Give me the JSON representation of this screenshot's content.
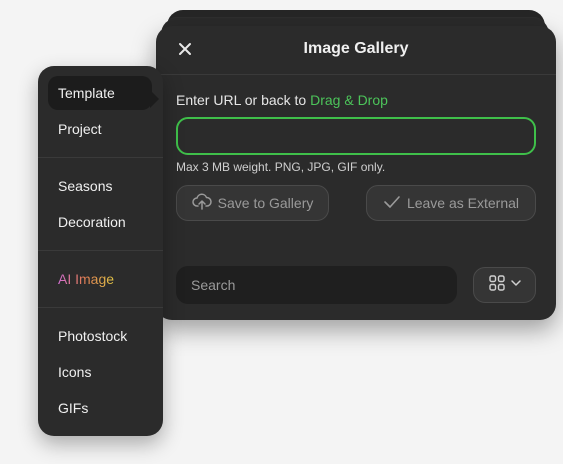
{
  "dialog": {
    "title": "Image Gallery",
    "url_prompt": "Enter URL or back to",
    "url_link": "Drag & Drop",
    "url_input_value": "",
    "hint": "Max 3 MB weight. PNG, JPG, GIF only.",
    "save_label": "Save to Gallery",
    "leave_label": "Leave as External",
    "search_placeholder": "Search",
    "accent_color": "#3fbf4a"
  },
  "sidebar": {
    "items": [
      {
        "label": "Template",
        "active": true
      },
      {
        "label": "Project"
      },
      {
        "label": "Seasons"
      },
      {
        "label": "Decoration"
      },
      {
        "label": "AI Image"
      },
      {
        "label": "Photostock"
      },
      {
        "label": "Icons"
      },
      {
        "label": "GIFs"
      }
    ]
  }
}
